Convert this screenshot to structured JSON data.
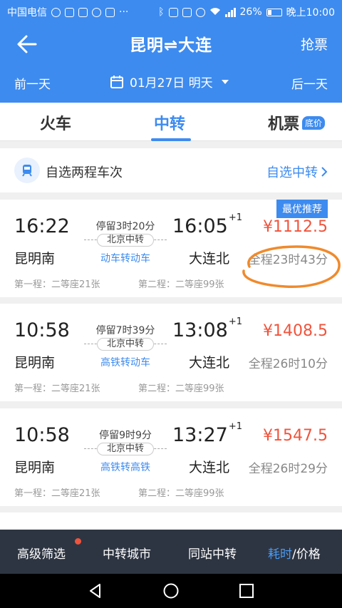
{
  "status_bar": {
    "carrier": "中国电信",
    "battery": "26%",
    "time": "晚上10:00",
    "network": "4G"
  },
  "header": {
    "route": "昆明⇌大连",
    "grab_ticket": "抢票",
    "prev_day": "前一天",
    "next_day": "后一天",
    "date": "01月27日 明天"
  },
  "tabs": [
    {
      "label": "火车"
    },
    {
      "label": "中转"
    },
    {
      "label": "机票",
      "badge": "底价"
    }
  ],
  "self_select": {
    "label": "自选两程车次",
    "link": "自选中转"
  },
  "colors": {
    "primary": "#3d8bef",
    "price": "#f0543c",
    "annotation": "#f08a2c"
  },
  "results": [
    {
      "badge": "最优推荐",
      "dep_time": "16:22",
      "dep_station": "昆明南",
      "stay": "停留3时20分",
      "transfer_station": "北京中转",
      "train_type": "动车转动车",
      "arr_time": "16:05",
      "day_offset": "+1",
      "arr_station": "大连北",
      "price": "¥1112.5",
      "duration": "全程23时43分",
      "leg1": "第一程：二等座21张",
      "leg2": "第二程：二等座99张"
    },
    {
      "dep_time": "10:58",
      "dep_station": "昆明南",
      "stay": "停留7时39分",
      "transfer_station": "北京中转",
      "train_type": "高铁转动车",
      "arr_time": "13:08",
      "day_offset": "+1",
      "arr_station": "大连北",
      "price": "¥1408.5",
      "duration": "全程26时10分",
      "leg1": "第一程：二等座21张",
      "leg2": "第二程：二等座99张"
    },
    {
      "dep_time": "10:58",
      "dep_station": "昆明南",
      "stay": "停留9时9分",
      "transfer_station": "北京中转",
      "train_type": "高铁转高铁",
      "arr_time": "13:27",
      "day_offset": "+1",
      "arr_station": "大连北",
      "price": "¥1547.5",
      "duration": "全程26时29分",
      "leg1": "第一程：二等座21张",
      "leg2": "第二程：二等座99张"
    }
  ],
  "filter_bar": {
    "advanced": "高级筛选",
    "transfer_city": "中转城市",
    "same_station": "同站中转",
    "sort_time": "耗时",
    "sort_sep": "/",
    "sort_price": "价格"
  }
}
